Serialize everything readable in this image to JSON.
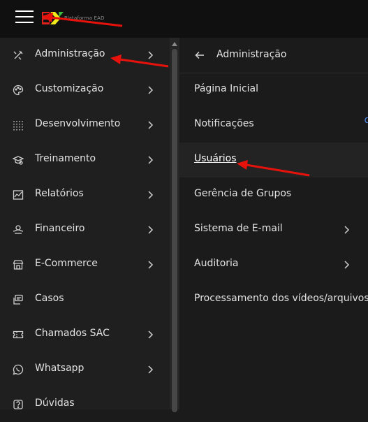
{
  "header": {
    "menu_icon": "hamburger-menu-icon",
    "logo_text": "Plataforma EAD",
    "colors": {
      "logo_red": "#e0201b",
      "logo_yellow": "#f3ea1c",
      "logo_green": "#3fbf3f"
    }
  },
  "sidebar": {
    "items": [
      {
        "label": "Administração",
        "icon": "tools-icon",
        "has_submenu": true
      },
      {
        "label": "Customização",
        "icon": "palette-icon",
        "has_submenu": true
      },
      {
        "label": "Desenvolvimento",
        "icon": "dev-grid-icon",
        "has_submenu": true
      },
      {
        "label": "Treinamento",
        "icon": "training-icon",
        "has_submenu": true
      },
      {
        "label": "Relatórios",
        "icon": "chart-icon",
        "has_submenu": true
      },
      {
        "label": "Financeiro",
        "icon": "money-icon",
        "has_submenu": true
      },
      {
        "label": "E-Commerce",
        "icon": "store-icon",
        "has_submenu": true
      },
      {
        "label": "Casos",
        "icon": "cases-icon",
        "has_submenu": false
      },
      {
        "label": "Chamados SAC",
        "icon": "ticket-icon",
        "has_submenu": true
      },
      {
        "label": "Whatsapp",
        "icon": "whatsapp-icon",
        "has_submenu": true
      },
      {
        "label": "Dúvidas",
        "icon": "help-icon",
        "has_submenu": false
      }
    ]
  },
  "submenu": {
    "title": "Administração",
    "back_icon": "arrow-left-icon",
    "items": [
      {
        "label": "Página Inicial",
        "has_submenu": false,
        "active": false
      },
      {
        "label": "Notificações",
        "has_submenu": false,
        "active": false
      },
      {
        "label": "Usuários",
        "has_submenu": false,
        "active": true
      },
      {
        "label": "Gerência de Grupos",
        "has_submenu": false,
        "active": false
      },
      {
        "label": "Sistema de E-mail",
        "has_submenu": true,
        "active": false
      },
      {
        "label": "Auditoria",
        "has_submenu": true,
        "active": false
      },
      {
        "label": "Processamento dos vídeos/arquivos",
        "has_submenu": false,
        "active": false
      }
    ]
  },
  "annotations": {
    "arrow_color": "#e8120c"
  }
}
